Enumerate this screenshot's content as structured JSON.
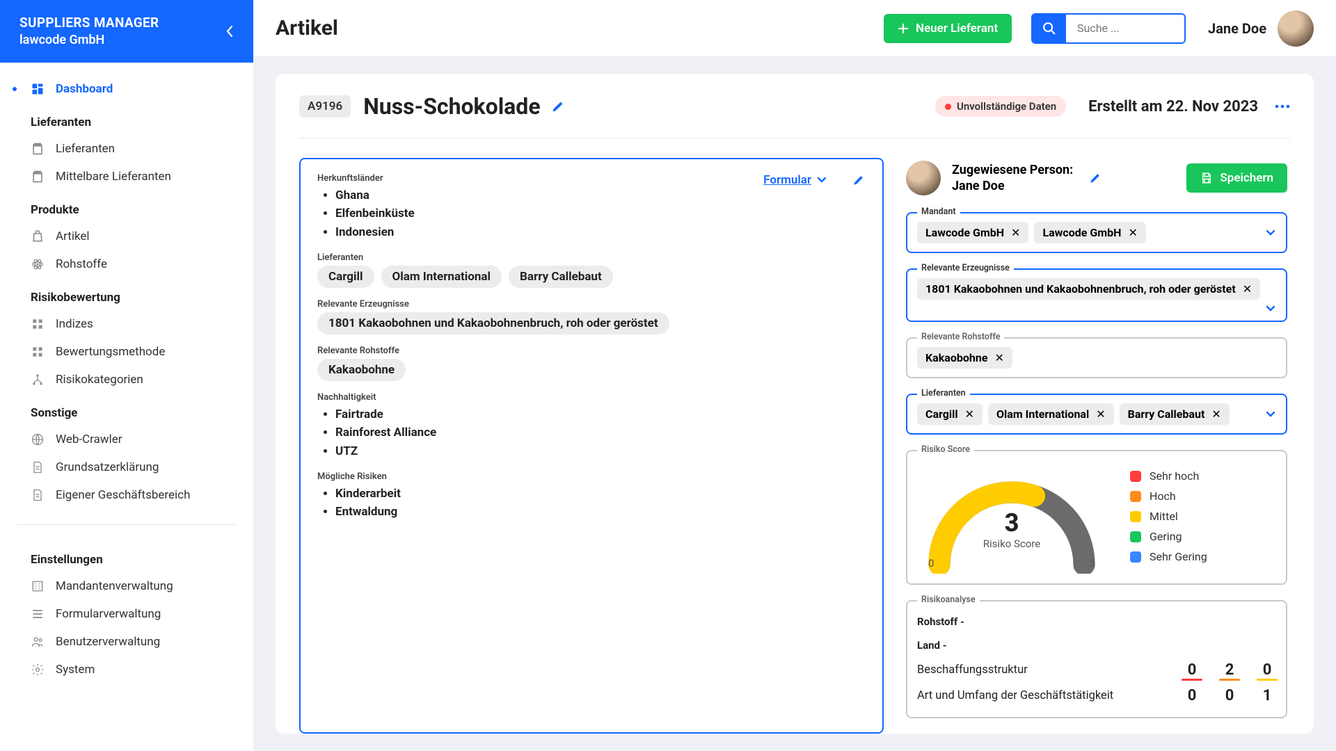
{
  "app": {
    "title": "SUPPLIERS MANAGER",
    "company": "lawcode GmbH"
  },
  "topbar": {
    "page_title": "Artikel",
    "new_supplier_btn": "Neuer Lieferant",
    "search_placeholder": "Suche ...",
    "user_name": "Jane Doe"
  },
  "nav": {
    "dashboard": "Dashboard",
    "section_suppliers": "Lieferanten",
    "suppliers": "Lieferanten",
    "indirect_suppliers": "Mittelbare Lieferanten",
    "section_products": "Produkte",
    "articles": "Artikel",
    "raw_materials": "Rohstoffe",
    "section_risk": "Risikobewertung",
    "indices": "Indizes",
    "method": "Bewertungsmethode",
    "risk_categories": "Risikokategorien",
    "section_other": "Sonstige",
    "web_crawler": "Web-Crawler",
    "principle_statement": "Grundsatzerklärung",
    "own_business_area": "Eigener Geschäftsbereich",
    "section_settings": "Einstellungen",
    "client_management": "Mandantenverwaltung",
    "form_management": "Formularverwaltung",
    "user_management": "Benutzerverwaltung",
    "system": "System"
  },
  "article": {
    "id": "A9196",
    "title": "Nuss-Schokolade",
    "status": "Unvollständige Daten",
    "created_label": "Erstellt am 22. Nov 2023",
    "form_link": "Formular",
    "section_countries": "Herkunftsländer",
    "countries": [
      "Ghana",
      "Elfenbeinküste",
      "Indonesien"
    ],
    "section_suppliers": "Lieferanten",
    "suppliers": [
      "Cargill",
      "Olam International",
      "Barry Callebaut"
    ],
    "section_products": "Relevante Erzeugnisse",
    "products": [
      "1801 Kakaobohnen und Kakaobohnenbruch, roh oder geröstet"
    ],
    "section_materials": "Relevante Rohstoffe",
    "materials": [
      "Kakaobohne"
    ],
    "section_sustainability": "Nachhaltigkeit",
    "sustainability": [
      "Fairtrade",
      "Rainforest Alliance",
      "UTZ"
    ],
    "section_risks": "Mögliche Risiken",
    "risks": [
      "Kinderarbeit",
      "Entwaldung"
    ]
  },
  "right": {
    "assignee_label": "Zugewiesene Person:",
    "assignee_name": "Jane Doe",
    "save_btn": "Speichern",
    "field_mandant": "Mandant",
    "mandants": [
      "Lawcode GmbH",
      "Lawcode GmbH"
    ],
    "field_products": "Relevante Erzeugnisse",
    "products": [
      "1801 Kakaobohnen und Kakaobohnenbruch, roh oder geröstet"
    ],
    "field_materials": "Relevante Rohstoffe",
    "materials": [
      "Kakaobohne"
    ],
    "field_suppliers": "Lieferanten",
    "suppliers": [
      "Cargill",
      "Olam International",
      "Barry Callebaut"
    ],
    "field_risk_score": "Risiko Score",
    "risk_score_value": "3",
    "risk_score_label": "Risiko Score",
    "gauge_min": "0",
    "gauge_max": "5",
    "legend": [
      {
        "label": "Sehr hoch",
        "color": "#ff3d3d"
      },
      {
        "label": "Hoch",
        "color": "#ff8c1a"
      },
      {
        "label": "Mittel",
        "color": "#ffcc00"
      },
      {
        "label": "Gering",
        "color": "#19c65b"
      },
      {
        "label": "Sehr Gering",
        "color": "#3a86ff"
      }
    ],
    "field_analysis": "Risikoanalyse",
    "analysis_rohstoff": "Rohstoff -",
    "analysis_land": "Land -",
    "row1_label": "Beschaffungsstruktur",
    "row1_vals": [
      "0",
      "2",
      "0"
    ],
    "row2_label": "Art und Umfang der Geschäftstätigkeit",
    "row2_vals": [
      "0",
      "0",
      "1"
    ]
  },
  "chart_data": {
    "type": "gauge",
    "title": "Risiko Score",
    "value": 3,
    "min": 0,
    "max": 5,
    "legend": [
      "Sehr hoch",
      "Hoch",
      "Mittel",
      "Gering",
      "Sehr Gering"
    ],
    "colors": [
      "#ff3d3d",
      "#ff8c1a",
      "#ffcc00",
      "#19c65b",
      "#3a86ff"
    ]
  }
}
